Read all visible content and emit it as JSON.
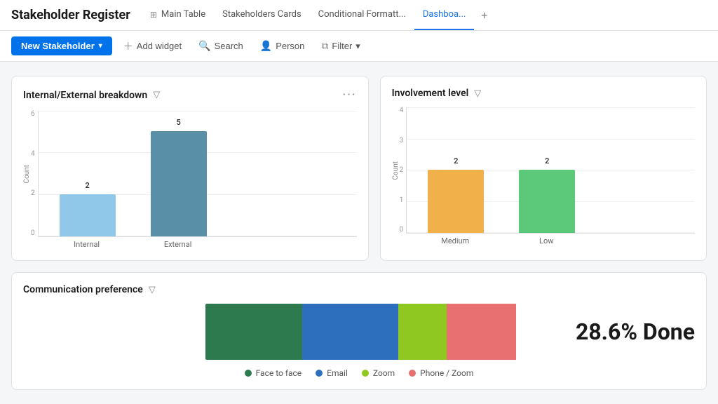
{
  "app": {
    "title": "Stakeholder Register"
  },
  "nav": {
    "tabs": [
      {
        "id": "main-table",
        "label": "Main Table",
        "icon": "⊞",
        "active": false
      },
      {
        "id": "stakeholders-cards",
        "label": "Stakeholders Cards",
        "icon": "",
        "active": false
      },
      {
        "id": "conditional-format",
        "label": "Conditional Formatt...",
        "icon": "",
        "active": false
      },
      {
        "id": "dashboard",
        "label": "Dashboa...",
        "icon": "",
        "active": true
      },
      {
        "id": "add-tab",
        "label": "+",
        "icon": "",
        "active": false
      }
    ]
  },
  "toolbar": {
    "new_stakeholder": "New Stakeholder",
    "add_widget": "Add widget",
    "search": "Search",
    "person": "Person",
    "filter": "Filter"
  },
  "breakdown_chart": {
    "title": "Internal/External breakdown",
    "y_axis_label": "Count",
    "y_ticks": [
      "0",
      "2",
      "4",
      "6"
    ],
    "bars": [
      {
        "label": "Internal",
        "value": 2,
        "color": "#8fc8e8",
        "height_pct": 33
      },
      {
        "label": "External",
        "value": 5,
        "color": "#5a8fa8",
        "height_pct": 83
      }
    ]
  },
  "involvement_chart": {
    "title": "Involvement level",
    "y_axis_label": "Count",
    "y_ticks": [
      "0",
      "1",
      "2",
      "3",
      "4"
    ],
    "bars": [
      {
        "label": "Medium",
        "value": 2,
        "color": "#f0b04a",
        "height_pct": 50
      },
      {
        "label": "Low",
        "value": 2,
        "color": "#5cc87a",
        "height_pct": 50
      }
    ]
  },
  "comm_chart": {
    "title": "Communication preference",
    "done_text": "28.6% Done",
    "segments": [
      {
        "label": "Face to face",
        "color": "#2d7a4f",
        "width_pct": 28
      },
      {
        "label": "Email",
        "color": "#2d6fbd",
        "width_pct": 28
      },
      {
        "label": "Zoom",
        "color": "#8fc820",
        "width_pct": 14
      },
      {
        "label": "Phone / Zoom",
        "color": "#e87070",
        "width_pct": 20
      }
    ],
    "legend": [
      {
        "label": "Face to face",
        "color": "#2d7a4f"
      },
      {
        "label": "Email",
        "color": "#2d6fbd"
      },
      {
        "label": "Zoom",
        "color": "#8fc820"
      },
      {
        "label": "Phone / Zoom",
        "color": "#e87070"
      }
    ]
  }
}
